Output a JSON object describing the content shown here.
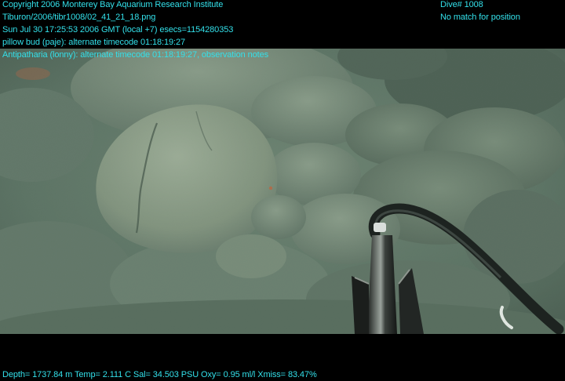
{
  "overlay": {
    "copyright": "Copyright 2006 Monterey Bay Aquarium Research Institute",
    "file": "Tiburon/2006/tibr1008/02_41_21_18.png",
    "datetime": "Sun Jul 30 17:25:53 2006 GMT (local +7)  esecs=1154280353",
    "annotation_1": "pillow bud (paje): alternate timecode 01:18:19:27",
    "annotation_2": "Antipatharia (lonny): alternate timecode 01:18:19:27, observation notes",
    "dive": "Dive# 1008",
    "position": "No match for position",
    "telemetry": "Depth= 1737.84 m  Temp= 2.111 C  Sal= 34.503 PSU  Oxy= 0.95 ml/l  Xmiss= 83.47%"
  },
  "colors": {
    "overlay_text": "#33e0ea",
    "water": "#4f6a5c",
    "rock": "#8b9e86",
    "band": "#000000"
  },
  "scene": {
    "subject": "seafloor-pillow-lava",
    "tool": "rov-sampling-arm-and-hose"
  }
}
